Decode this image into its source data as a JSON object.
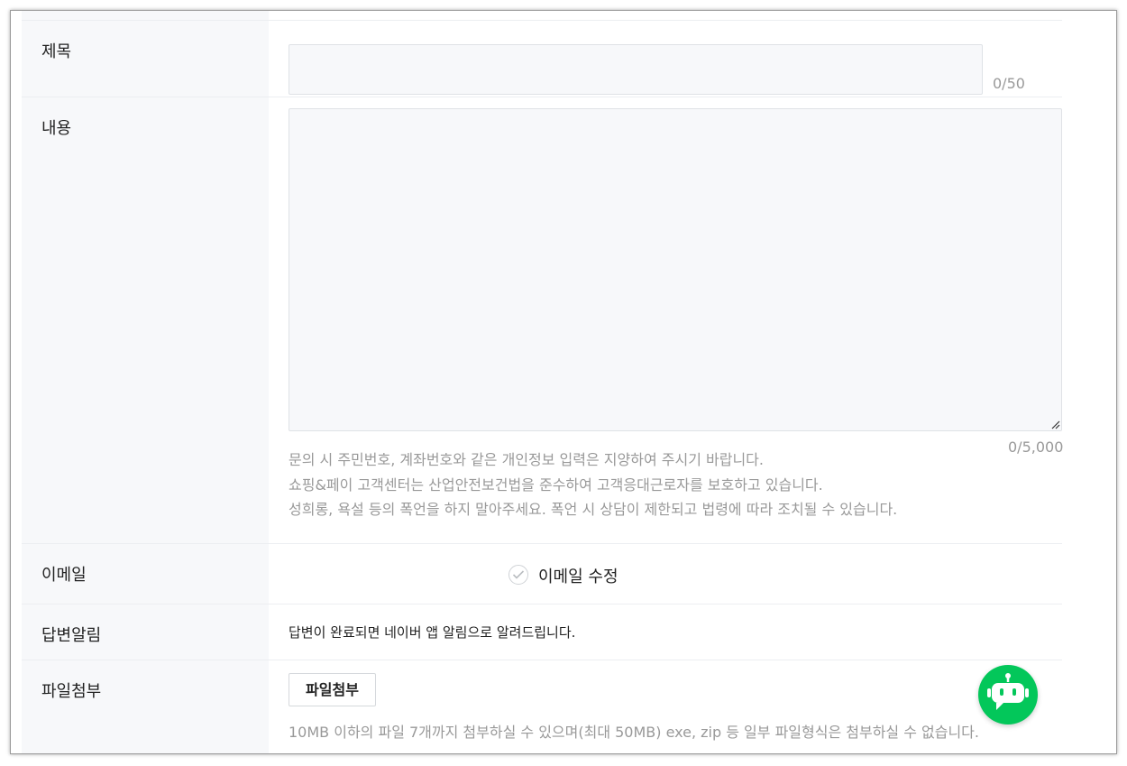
{
  "form": {
    "title": {
      "label": "제목",
      "value": "",
      "counter": "0/50"
    },
    "content": {
      "label": "내용",
      "value": "",
      "counter": "0/5,000",
      "notices": [
        "문의 시 주민번호, 계좌번호와 같은 개인정보 입력은 지양하여 주시기 바랍니다.",
        "쇼핑&페이 고객센터는 산업안전보건법을 준수하여 고객응대근로자를 보호하고 있습니다.",
        "성희롱, 욕설 등의 폭언을 하지 말아주세요. 폭언 시 상담이 제한되고 법령에 따라 조치될 수 있습니다."
      ]
    },
    "email": {
      "label": "이메일",
      "edit_label": "이메일 수정"
    },
    "answer_notice": {
      "label": "답변알림",
      "text": "답변이 완료되면 네이버 앱 알림으로 알려드립니다."
    },
    "attachment": {
      "label": "파일첨부",
      "button_label": "파일첨부",
      "hint": "10MB 이하의 파일 7개까지 첨부하실 수 있으며(최대 50MB) exe, zip 등 일부 파일형식은 첨부하실 수 없습니다."
    }
  },
  "chatbot": {
    "icon": "robot-icon",
    "color": "#03c75a"
  }
}
